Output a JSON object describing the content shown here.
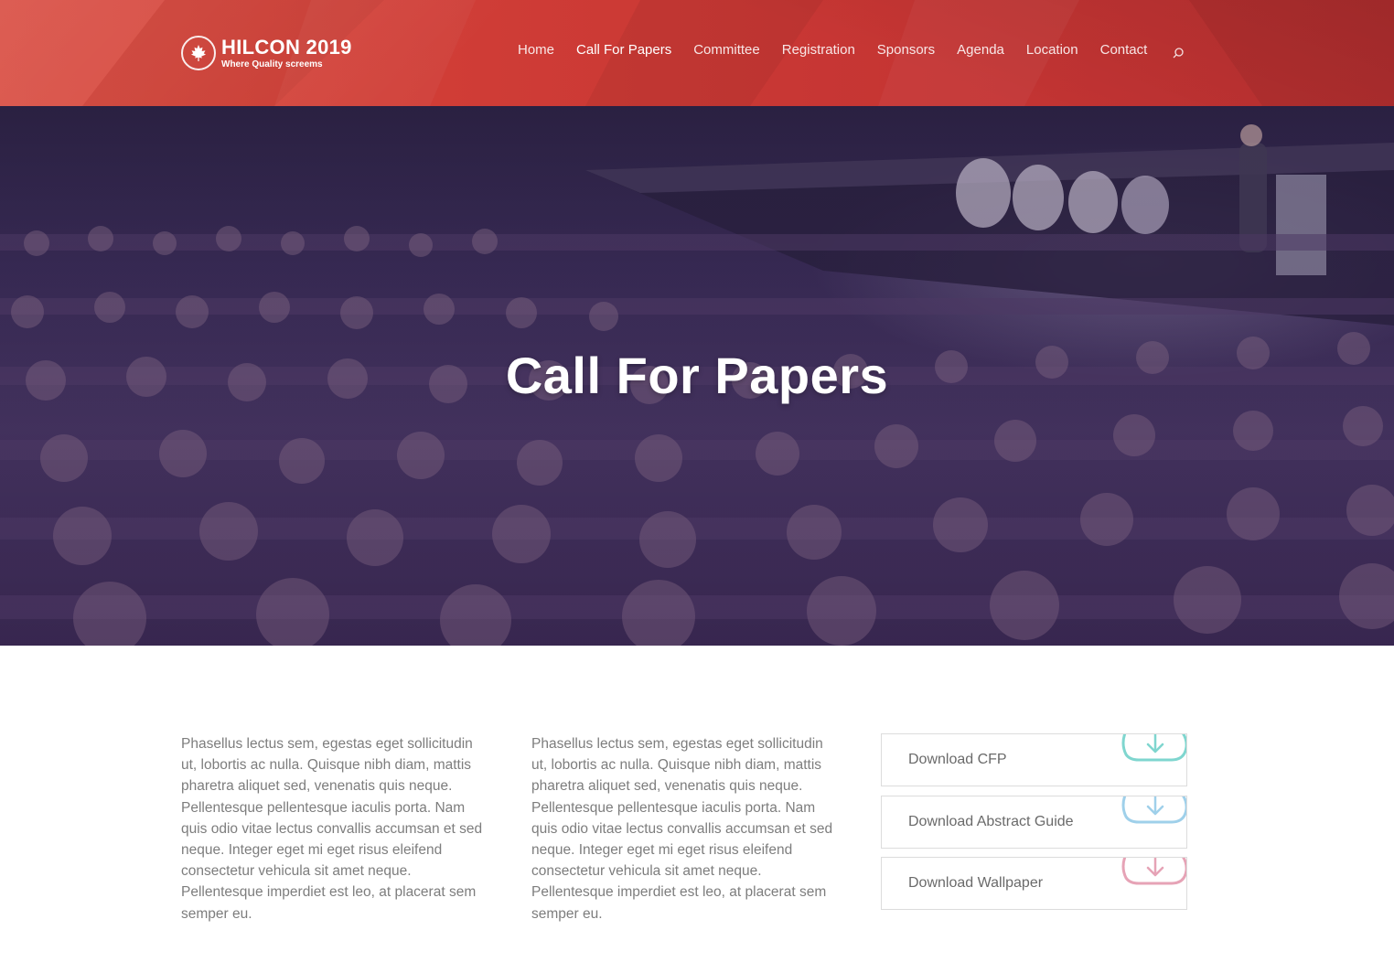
{
  "brand": {
    "title": "HILCON 2019",
    "tagline": "Where Quality screems",
    "icon": "maple-leaf-icon"
  },
  "nav": {
    "items": [
      {
        "label": "Home",
        "active": false
      },
      {
        "label": "Call For Papers",
        "active": true
      },
      {
        "label": "Committee",
        "active": false
      },
      {
        "label": "Registration",
        "active": false
      },
      {
        "label": "Sponsors",
        "active": false
      },
      {
        "label": "Agenda",
        "active": false
      },
      {
        "label": "Location",
        "active": false
      },
      {
        "label": "Contact",
        "active": false
      }
    ],
    "search_icon": "search-icon"
  },
  "hero": {
    "title": "Call For Papers"
  },
  "content": {
    "column_1": "Phasellus lectus sem, egestas eget sollicitudin ut, lobortis ac nulla. Quisque nibh diam, mattis pharetra aliquet sed, venenatis quis neque. Pellentesque pellentesque iaculis porta. Nam quis odio vitae lectus convallis accumsan et sed neque. Integer eget mi eget risus eleifend consectetur vehicula sit amet neque. Pellentesque imperdiet est leo, at placerat sem semper eu.",
    "column_2": "Phasellus lectus sem, egestas eget sollicitudin ut, lobortis ac nulla. Quisque nibh diam, mattis pharetra aliquet sed, venenatis quis neque. Pellentesque pellentesque iaculis porta. Nam quis odio vitae lectus convallis accumsan et sed neque. Integer eget mi eget risus eleifend consectetur vehicula sit amet neque. Pellentesque imperdiet est leo, at placerat sem semper eu."
  },
  "downloads": [
    {
      "label": "Download CFP",
      "icon": "cloud-download-icon",
      "icon_color": "#7fd6cf"
    },
    {
      "label": "Download Abstract Guide",
      "icon": "cloud-download-icon",
      "icon_color": "#9fd0ea"
    },
    {
      "label": "Download Wallpaper",
      "icon": "cloud-download-icon",
      "icon_color": "#e6a3b6"
    }
  ],
  "colors": {
    "header_red": "#cf3c36",
    "hero_overlay": "#3a2f55",
    "body_text": "#7d7d7d"
  }
}
